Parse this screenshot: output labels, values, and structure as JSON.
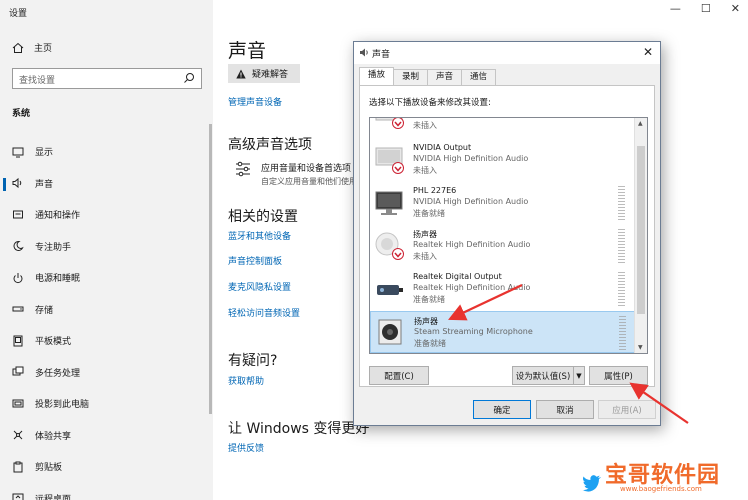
{
  "settings": {
    "app_title": "设置",
    "window_controls": [
      "—",
      "☐",
      "✕"
    ],
    "home": "主页",
    "search_placeholder": "查找设置",
    "section": "系统",
    "nav": [
      {
        "label": "显示",
        "icon": "display-icon",
        "active": false
      },
      {
        "label": "声音",
        "icon": "speaker-icon",
        "active": true
      },
      {
        "label": "通知和操作",
        "icon": "notification-icon",
        "active": false
      },
      {
        "label": "专注助手",
        "icon": "moon-icon",
        "active": false
      },
      {
        "label": "电源和睡眠",
        "icon": "power-icon",
        "active": false
      },
      {
        "label": "存储",
        "icon": "storage-icon",
        "active": false
      },
      {
        "label": "平板模式",
        "icon": "tablet-icon",
        "active": false
      },
      {
        "label": "多任务处理",
        "icon": "multitask-icon",
        "active": false
      },
      {
        "label": "投影到此电脑",
        "icon": "project-icon",
        "active": false
      },
      {
        "label": "体验共享",
        "icon": "share-icon",
        "active": false
      },
      {
        "label": "剪贴板",
        "icon": "clipboard-icon",
        "active": false
      },
      {
        "label": "远程桌面",
        "icon": "remote-desktop-icon",
        "active": false
      }
    ],
    "main": {
      "title": "声音",
      "troubleshoot": "疑难解答",
      "manage_devices": "管理声音设备",
      "advanced_heading": "高级声音选项",
      "app_volume_title": "应用音量和设备首选项",
      "app_volume_desc": "自定义应用音量和他们使用的扬声器",
      "related_heading": "相关的设置",
      "related_links": [
        "蓝牙和其他设备",
        "声音控制面板",
        "麦克风隐私设置",
        "轻松访问音频设置"
      ],
      "question_heading": "有疑问?",
      "get_help": "获取帮助",
      "improve_heading": "让 Windows 变得更好",
      "feedback": "提供反馈"
    }
  },
  "dialog": {
    "title": "声音",
    "close": "✕",
    "tabs": [
      "播放",
      "录制",
      "声音",
      "通信"
    ],
    "active_tab": 0,
    "instruction": "选择以下播放设备来修改其设置:",
    "devices": [
      {
        "name": "",
        "desc": "NVIDIA High Definition Audio",
        "status": "未插入",
        "icon": "monitor-disconnected-icon",
        "selected": false
      },
      {
        "name": "NVIDIA Output",
        "desc": "NVIDIA High Definition Audio",
        "status": "未插入",
        "icon": "monitor-disconnected-icon",
        "selected": false
      },
      {
        "name": "PHL 227E6",
        "desc": "NVIDIA High Definition Audio",
        "status": "准备就绪",
        "icon": "monitor-icon",
        "selected": false
      },
      {
        "name": "扬声器",
        "desc": "Realtek High Definition Audio",
        "status": "未插入",
        "icon": "speaker-disconnected-icon",
        "selected": false
      },
      {
        "name": "Realtek Digital Output",
        "desc": "Realtek High Definition Audio",
        "status": "准备就绪",
        "icon": "digital-output-icon",
        "selected": false
      },
      {
        "name": "扬声器",
        "desc": "Steam Streaming Microphone",
        "status": "准备就绪",
        "icon": "speaker-box-icon",
        "selected": true
      }
    ],
    "buttons": {
      "configure": "配置(C)",
      "set_default": "设为默认值(S)",
      "dropdown": "▼",
      "properties": "属性(P)",
      "ok": "确定",
      "cancel": "取消",
      "apply": "应用(A)"
    }
  },
  "watermark": {
    "text": "宝哥软件园",
    "url": "www.baogefriends.com"
  }
}
